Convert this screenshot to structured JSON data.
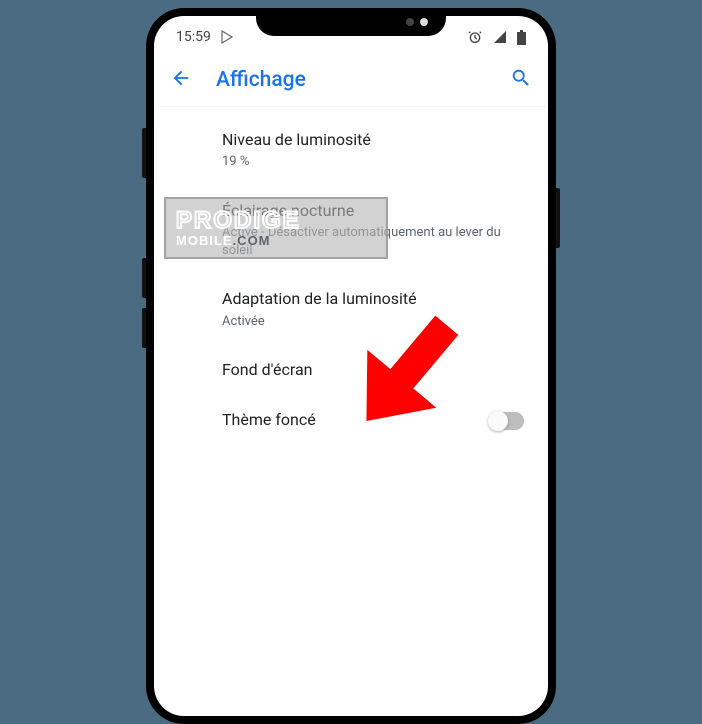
{
  "status": {
    "time": "15:59",
    "icons": {
      "play": "▷",
      "alarm": "⏰",
      "signal": "◢",
      "battery": "▮"
    }
  },
  "appbar": {
    "title": "Affichage"
  },
  "settings": {
    "brightness": {
      "title": "Niveau de luminosité",
      "subtitle": "19 %"
    },
    "nightlight": {
      "title": "Éclairage nocturne",
      "subtitle": "Activé - Désactiver automatiquement au lever du soleil"
    },
    "adaptive": {
      "title": "Adaptation de la luminosité",
      "subtitle": "Activée"
    },
    "wallpaper": {
      "title": "Fond d'écran"
    },
    "darktheme": {
      "title": "Thème foncé",
      "enabled": false
    }
  },
  "watermark": {
    "line1": "PRODIGE",
    "line2a": "MOBILE",
    "line2b": ".COM"
  }
}
